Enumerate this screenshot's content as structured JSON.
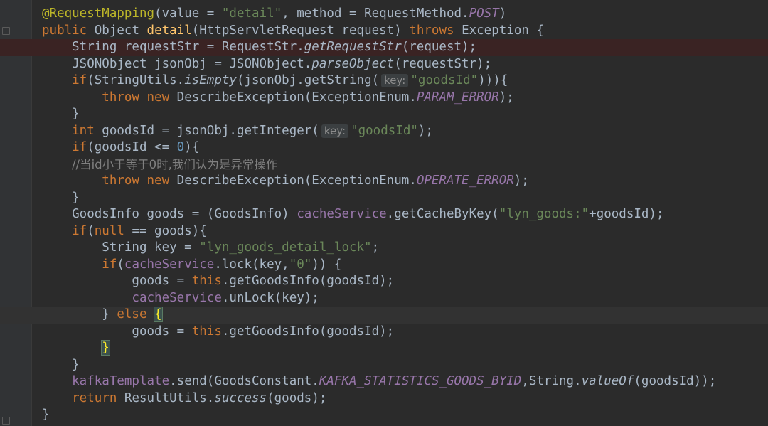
{
  "editor": {
    "lines": [
      [
        [
          "ann",
          "@RequestMapping"
        ],
        [
          "p",
          "("
        ],
        [
          "p",
          "value = "
        ],
        [
          "str",
          "\"detail\""
        ],
        [
          "p",
          ", "
        ],
        [
          "p",
          "method = RequestMethod."
        ],
        [
          "const",
          "POST"
        ],
        [
          "p",
          ")"
        ]
      ],
      [
        [
          "kw",
          "public "
        ],
        [
          "p",
          "Object "
        ],
        [
          "fn",
          "detail"
        ],
        [
          "p",
          "(HttpServletRequest request) "
        ],
        [
          "kw",
          "throws "
        ],
        [
          "p",
          "Exception {"
        ]
      ],
      [
        [
          "p",
          "    String requestStr = RequestStr."
        ],
        [
          "sfn",
          "getRequestStr"
        ],
        [
          "p",
          "(request);"
        ]
      ],
      [
        [
          "p",
          "    JSONObject jsonObj = JSONObject."
        ],
        [
          "sfn",
          "parseObject"
        ],
        [
          "p",
          "(requestStr);"
        ]
      ],
      [
        [
          "kw",
          "    if"
        ],
        [
          "p",
          "(StringUtils."
        ],
        [
          "sfn",
          "isEmpty"
        ],
        [
          "p",
          "(jsonObj.getString("
        ],
        [
          "hint",
          "key:"
        ],
        [
          "str",
          "\"goodsId\""
        ],
        [
          "p",
          "))){"
        ]
      ],
      [
        [
          "kw",
          "        throw new "
        ],
        [
          "p",
          "DescribeException(ExceptionEnum."
        ],
        [
          "const",
          "PARAM_ERROR"
        ],
        [
          "p",
          ");"
        ]
      ],
      [
        [
          "p",
          "    }"
        ]
      ],
      [
        [
          "kw",
          "    int "
        ],
        [
          "p",
          "goodsId = jsonObj.getInteger("
        ],
        [
          "hint",
          "key:"
        ],
        [
          "str",
          "\"goodsId\""
        ],
        [
          "p",
          ");"
        ]
      ],
      [
        [
          "kw",
          "    if"
        ],
        [
          "p",
          "(goodsId <= "
        ],
        [
          "num",
          "0"
        ],
        [
          "p",
          "){"
        ]
      ],
      [
        [
          "cmt",
          "        //当id小于等于0时,我们认为是异常操作"
        ]
      ],
      [
        [
          "kw",
          "        throw new "
        ],
        [
          "p",
          "DescribeException(ExceptionEnum."
        ],
        [
          "const",
          "OPERATE_ERROR"
        ],
        [
          "p",
          ");"
        ]
      ],
      [
        [
          "p",
          "    }"
        ]
      ],
      [
        [
          "p",
          "    GoodsInfo goods = (GoodsInfo) "
        ],
        [
          "fld",
          "cacheService"
        ],
        [
          "p",
          ".getCacheByKey("
        ],
        [
          "str",
          "\"lyn_goods:\""
        ],
        [
          "p",
          "+goodsId);"
        ]
      ],
      [
        [
          "kw",
          "    if"
        ],
        [
          "p",
          "("
        ],
        [
          "kw",
          "null "
        ],
        [
          "p",
          "== goods){"
        ]
      ],
      [
        [
          "p",
          "        String key = "
        ],
        [
          "str",
          "\"lyn_goods_detail_lock\""
        ],
        [
          "p",
          ";"
        ]
      ],
      [
        [
          "kw",
          "        if"
        ],
        [
          "p",
          "("
        ],
        [
          "fld",
          "cacheService"
        ],
        [
          "p",
          ".lock(key,"
        ],
        [
          "str",
          "\"0\""
        ],
        [
          "p",
          ")) {"
        ]
      ],
      [
        [
          "p",
          "            goods = "
        ],
        [
          "kw",
          "this"
        ],
        [
          "p",
          ".getGoodsInfo(goodsId);"
        ]
      ],
      [
        [
          "fld",
          "            cacheService"
        ],
        [
          "p",
          ".unLock(key);"
        ]
      ],
      [
        [
          "p",
          "        } "
        ],
        [
          "kw",
          "else "
        ],
        [
          "brace",
          "{"
        ]
      ],
      [
        [
          "p",
          "            goods = "
        ],
        [
          "kw",
          "this"
        ],
        [
          "p",
          ".getGoodsInfo(goodsId);"
        ]
      ],
      [
        [
          "p",
          "        "
        ],
        [
          "brace",
          "}"
        ]
      ],
      [
        [
          "p",
          "    }"
        ]
      ],
      [
        [
          "fld",
          "    kafkaTemplate"
        ],
        [
          "p",
          ".send(GoodsConstant."
        ],
        [
          "const",
          "KAFKA_STATISTICS_GOODS_BYID"
        ],
        [
          "p",
          ",String."
        ],
        [
          "sfn",
          "valueOf"
        ],
        [
          "p",
          "(goodsId));"
        ]
      ],
      [
        [
          "kw",
          "    return "
        ],
        [
          "p",
          "ResultUtils."
        ],
        [
          "sfn",
          "success"
        ],
        [
          "p",
          "(goods);"
        ]
      ],
      [
        [
          "p",
          "}"
        ]
      ]
    ],
    "colors": {
      "background": "#2b2b2b",
      "keyword": "#cc7832",
      "annotation": "#bbb529",
      "string": "#6a8759",
      "number": "#6897bb",
      "field": "#9876aa",
      "method": "#ffc66d",
      "comment": "#808080",
      "plain": "#a9b7c6"
    }
  }
}
